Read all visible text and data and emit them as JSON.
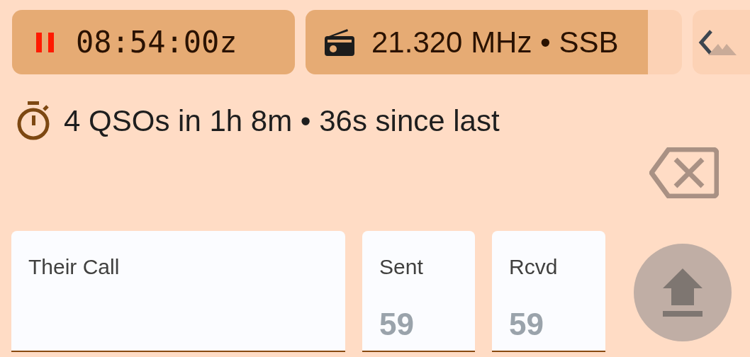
{
  "clock": {
    "time": "08:54:00z",
    "paused": true
  },
  "frequency": {
    "text": "21.320 MHz • SSB",
    "level": 0.91
  },
  "stats": {
    "text": "4 QSOs in 1h 8m • 36s since last"
  },
  "fields": [
    {
      "label": "Their Call"
    },
    {
      "label": "Sent",
      "placeholder": "59"
    },
    {
      "label": "Rcvd",
      "placeholder": "59"
    }
  ]
}
